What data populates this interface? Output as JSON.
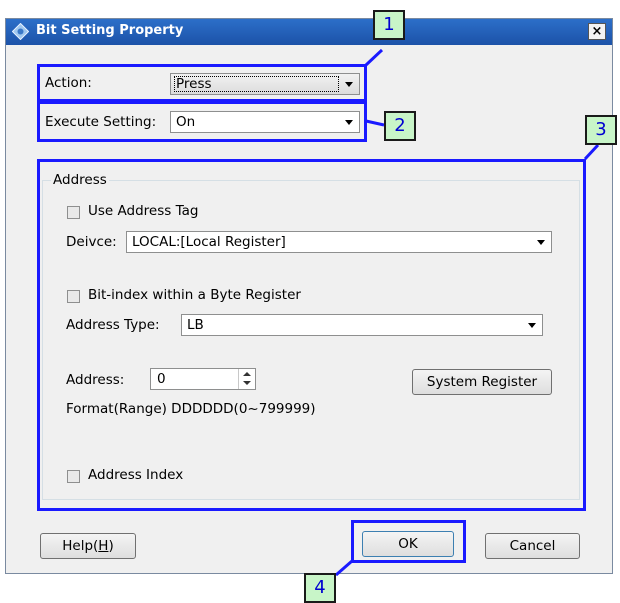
{
  "dialog": {
    "title": "Bit Setting Property",
    "close_label": "×"
  },
  "action": {
    "label": "Action:",
    "value": "Press"
  },
  "execute": {
    "label": "Execute Setting:",
    "value": "On"
  },
  "address_group": {
    "title": "Address",
    "use_address_tag_label": "Use Address Tag",
    "device_label": "Deivce:",
    "device_value": "LOCAL:[Local Register]",
    "bit_index_label": "Bit-index within a Byte Register",
    "address_type_label": "Address Type:",
    "address_type_value": "LB",
    "address_label": "Address:",
    "address_value": "0",
    "system_register_label": "System Register",
    "format_text": "Format(Range) DDDDDD(0~799999)",
    "address_index_label": "Address Index"
  },
  "buttons": {
    "help": "Help(",
    "help_mnemonic": "H",
    "help_close": ")",
    "ok": "OK",
    "cancel": "Cancel"
  },
  "annotations": [
    "1",
    "2",
    "3",
    "4"
  ],
  "colors": {
    "highlight": "#1a1aff",
    "badge_bg": "#c8f5c8",
    "title_bar": "#1c52a8"
  }
}
